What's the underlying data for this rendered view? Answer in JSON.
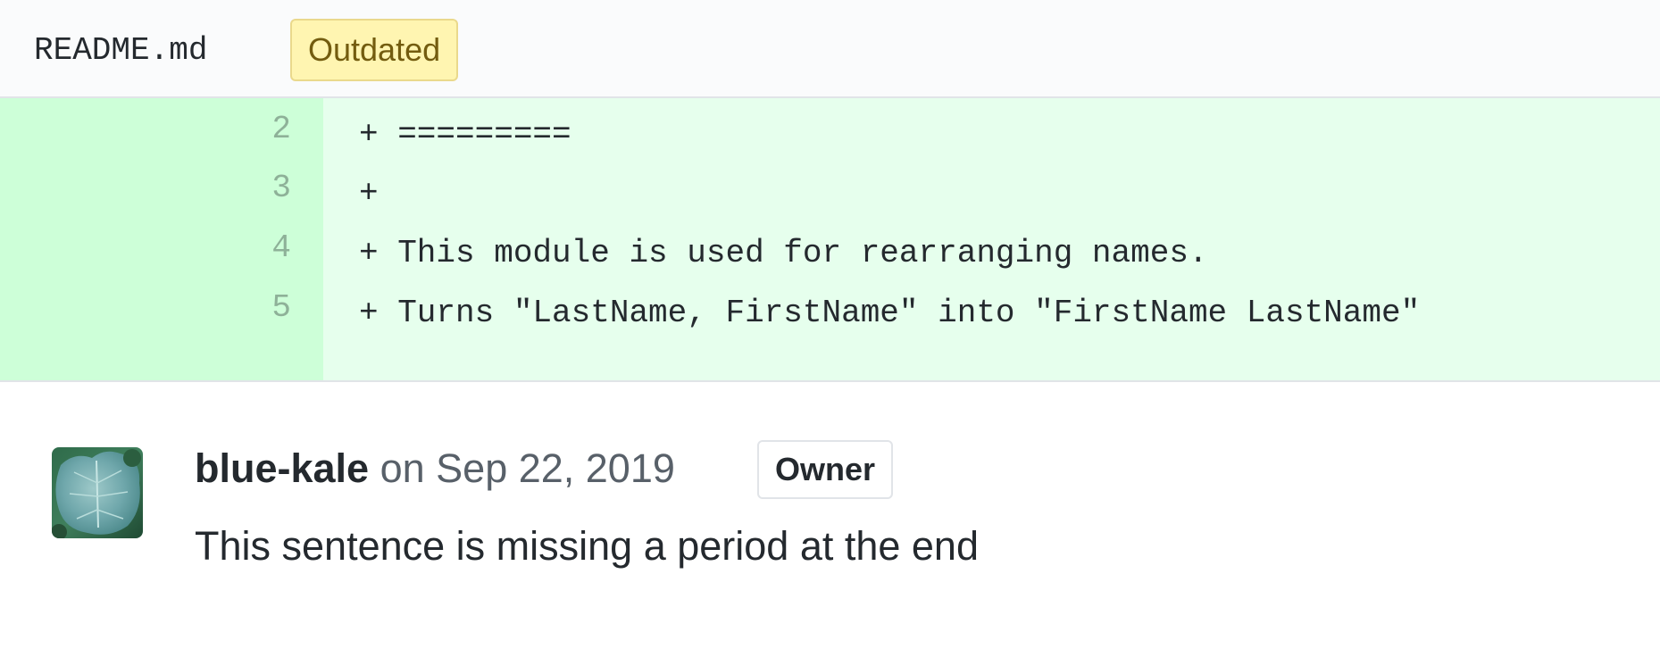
{
  "file": {
    "name": "README.md",
    "status_badge": "Outdated"
  },
  "diff": {
    "lines": [
      {
        "number": "2",
        "text": "+ ========="
      },
      {
        "number": "3",
        "text": "+"
      },
      {
        "number": "4",
        "text": "+ This module is used for rearranging names."
      },
      {
        "number": "5",
        "text": "+ Turns \"LastName, FirstName\" into \"FirstName LastName\""
      }
    ]
  },
  "comment": {
    "author": "blue-kale",
    "timestamp": "on Sep 22, 2019",
    "role_badge": "Owner",
    "body": "This sentence is missing a period at the end",
    "avatar_icon": "leaf-avatar-icon"
  },
  "colors": {
    "added_line_bg": "#e6ffed",
    "added_gutter_bg": "#cdffd8",
    "outdated_badge_bg": "#fff5b1",
    "outdated_badge_text": "#735c0f"
  }
}
